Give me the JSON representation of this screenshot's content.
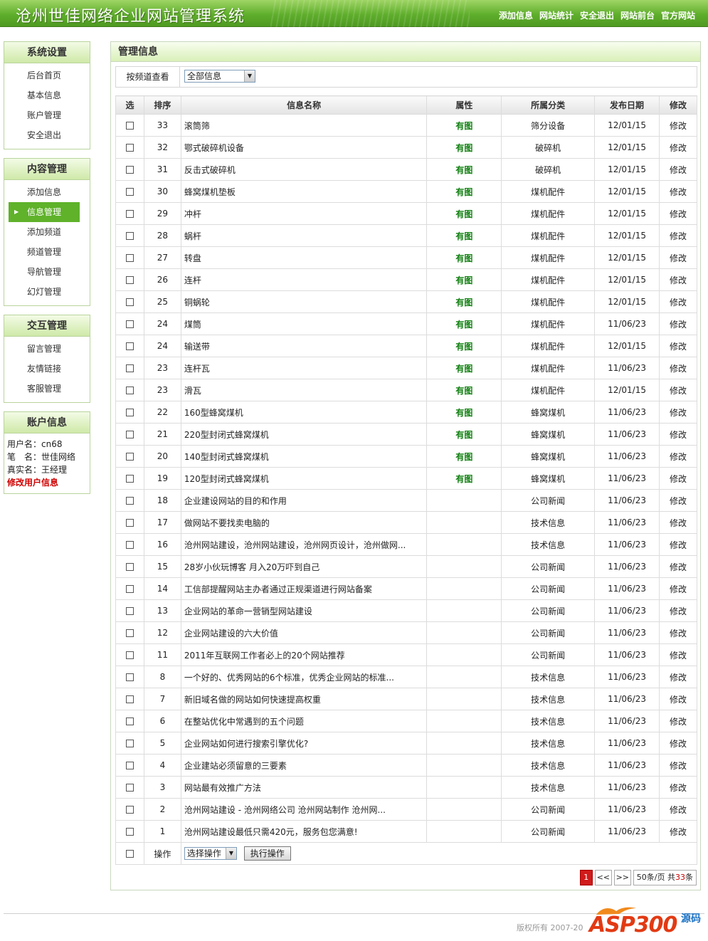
{
  "header": {
    "title": "沧州世佳网络企业网站管理系统",
    "nav": [
      "添加信息",
      "网站统计",
      "安全退出",
      "网站前台",
      "官方网站"
    ]
  },
  "sidebar": {
    "sections": [
      {
        "title": "系统设置",
        "items": [
          "后台首页",
          "基本信息",
          "账户管理",
          "安全退出"
        ]
      },
      {
        "title": "内容管理",
        "items": [
          "添加信息",
          "信息管理",
          "添加频道",
          "频道管理",
          "导航管理",
          "幻灯管理"
        ],
        "active": 1
      },
      {
        "title": "交互管理",
        "items": [
          "留言管理",
          "友情链接",
          "客服管理"
        ]
      }
    ],
    "account": {
      "title": "账户信息",
      "username": "用户名：cn68",
      "nickname": "笔　名：世佳网络",
      "realname": "真实名：王经理",
      "edit": "修改用户信息"
    }
  },
  "main": {
    "title": "管理信息",
    "filter_label": "按频道查看",
    "filter_value": "全部信息",
    "columns": [
      "选",
      "排序",
      "信息名称",
      "属性",
      "所属分类",
      "发布日期",
      "修改"
    ],
    "rows": [
      {
        "order": "33",
        "name": "滚筒筛",
        "attr": "有图",
        "cat": "筛分设备",
        "date": "12/01/15"
      },
      {
        "order": "32",
        "name": "鄂式破碎机设备",
        "attr": "有图",
        "cat": "破碎机",
        "date": "12/01/15"
      },
      {
        "order": "31",
        "name": "反击式破碎机",
        "attr": "有图",
        "cat": "破碎机",
        "date": "12/01/15"
      },
      {
        "order": "30",
        "name": "蜂窝煤机垫板",
        "attr": "有图",
        "cat": "煤机配件",
        "date": "12/01/15"
      },
      {
        "order": "29",
        "name": "冲杆",
        "attr": "有图",
        "cat": "煤机配件",
        "date": "12/01/15"
      },
      {
        "order": "28",
        "name": "蜗杆",
        "attr": "有图",
        "cat": "煤机配件",
        "date": "12/01/15"
      },
      {
        "order": "27",
        "name": "转盘",
        "attr": "有图",
        "cat": "煤机配件",
        "date": "12/01/15"
      },
      {
        "order": "26",
        "name": "连杆",
        "attr": "有图",
        "cat": "煤机配件",
        "date": "12/01/15"
      },
      {
        "order": "25",
        "name": "铜蜗轮",
        "attr": "有图",
        "cat": "煤机配件",
        "date": "12/01/15"
      },
      {
        "order": "24",
        "name": "煤筒",
        "attr": "有图",
        "cat": "煤机配件",
        "date": "11/06/23"
      },
      {
        "order": "24",
        "name": "输送带",
        "attr": "有图",
        "cat": "煤机配件",
        "date": "12/01/15"
      },
      {
        "order": "23",
        "name": "连杆瓦",
        "attr": "有图",
        "cat": "煤机配件",
        "date": "11/06/23"
      },
      {
        "order": "23",
        "name": "滑瓦",
        "attr": "有图",
        "cat": "煤机配件",
        "date": "12/01/15"
      },
      {
        "order": "22",
        "name": "160型蜂窝煤机",
        "attr": "有图",
        "cat": "蜂窝煤机",
        "date": "11/06/23"
      },
      {
        "order": "21",
        "name": "220型封闭式蜂窝煤机",
        "attr": "有图",
        "cat": "蜂窝煤机",
        "date": "11/06/23"
      },
      {
        "order": "20",
        "name": "140型封闭式蜂窝煤机",
        "attr": "有图",
        "cat": "蜂窝煤机",
        "date": "11/06/23"
      },
      {
        "order": "19",
        "name": "120型封闭式蜂窝煤机",
        "attr": "有图",
        "cat": "蜂窝煤机",
        "date": "11/06/23"
      },
      {
        "order": "18",
        "name": "企业建设网站的目的和作用",
        "attr": "",
        "cat": "公司新闻",
        "date": "11/06/23"
      },
      {
        "order": "17",
        "name": "做网站不要找卖电脑的",
        "attr": "",
        "cat": "技术信息",
        "date": "11/06/23"
      },
      {
        "order": "16",
        "name": "沧州网站建设，沧州网站建设，沧州网页设计，沧州做网...",
        "attr": "",
        "cat": "技术信息",
        "date": "11/06/23"
      },
      {
        "order": "15",
        "name": "28岁小伙玩博客 月入20万吓到自己",
        "attr": "",
        "cat": "公司新闻",
        "date": "11/06/23"
      },
      {
        "order": "14",
        "name": "工信部提醒网站主办者通过正规渠道进行网站备案",
        "attr": "",
        "cat": "公司新闻",
        "date": "11/06/23"
      },
      {
        "order": "13",
        "name": "企业网站的革命一营销型网站建设",
        "attr": "",
        "cat": "公司新闻",
        "date": "11/06/23"
      },
      {
        "order": "12",
        "name": "企业网站建设的六大价值",
        "attr": "",
        "cat": "公司新闻",
        "date": "11/06/23"
      },
      {
        "order": "11",
        "name": "2011年互联网工作者必上的20个网站推荐",
        "attr": "",
        "cat": "公司新闻",
        "date": "11/06/23"
      },
      {
        "order": "8",
        "name": "一个好的、优秀网站的6个标准，优秀企业网站的标准...",
        "attr": "",
        "cat": "技术信息",
        "date": "11/06/23"
      },
      {
        "order": "7",
        "name": "新旧域名做的网站如何快速提高权重",
        "attr": "",
        "cat": "技术信息",
        "date": "11/06/23"
      },
      {
        "order": "6",
        "name": "在整站优化中常遇到的五个问题",
        "attr": "",
        "cat": "技术信息",
        "date": "11/06/23"
      },
      {
        "order": "5",
        "name": "企业网站如何进行搜索引擎优化?",
        "attr": "",
        "cat": "技术信息",
        "date": "11/06/23"
      },
      {
        "order": "4",
        "name": "企业建站必须留意的三要素",
        "attr": "",
        "cat": "技术信息",
        "date": "11/06/23"
      },
      {
        "order": "3",
        "name": "网站最有效推广方法",
        "attr": "",
        "cat": "技术信息",
        "date": "11/06/23"
      },
      {
        "order": "2",
        "name": "沧州网站建设 - 沧州网络公司 沧州网站制作 沧州网...",
        "attr": "",
        "cat": "公司新闻",
        "date": "11/06/23"
      },
      {
        "order": "1",
        "name": "沧州网站建设最低只需420元，服务包您满意!",
        "attr": "",
        "cat": "公司新闻",
        "date": "11/06/23"
      }
    ],
    "edit_label": "修改",
    "bulk_label": "操作",
    "bulk_select": "选择操作",
    "bulk_button": "执行操作"
  },
  "pager": {
    "current": "1",
    "prev": "<<",
    "next": ">>",
    "info_prefix": "50条/页 共",
    "total": "33",
    "info_suffix": "条"
  },
  "footer": {
    "copyright": "版权所有 2007-20",
    "logo_main": "ASP300",
    "logo_side": "源码"
  },
  "colors": {
    "header_green": "#5fae2c",
    "active_green": "#5fb22a",
    "attr_green": "#108010",
    "accent_red": "#d00000"
  }
}
